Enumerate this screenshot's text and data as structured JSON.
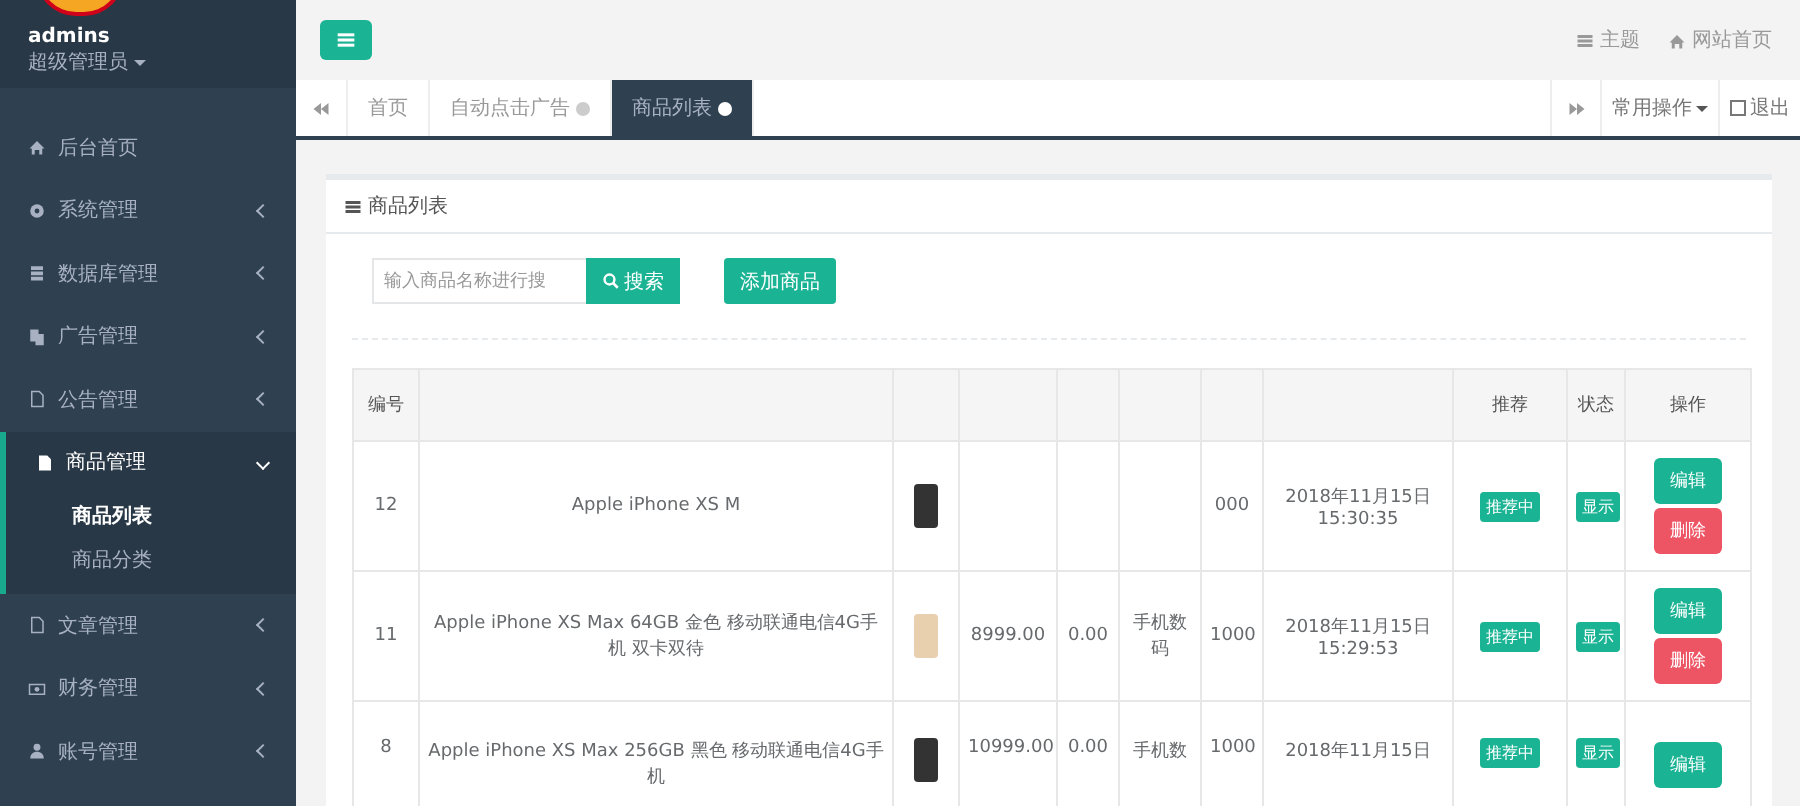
{
  "sidebar": {
    "user": {
      "name": "admins",
      "role": "超级管理员"
    },
    "items": [
      {
        "label": "后台首页",
        "has_children": false,
        "expanded": false
      },
      {
        "label": "系统管理",
        "has_children": true,
        "expanded": false
      },
      {
        "label": "数据库管理",
        "has_children": true,
        "expanded": false
      },
      {
        "label": "广告管理",
        "has_children": true,
        "expanded": false
      },
      {
        "label": "公告管理",
        "has_children": true,
        "expanded": false
      },
      {
        "label": "商品管理",
        "has_children": true,
        "expanded": true,
        "children": [
          {
            "label": "商品列表",
            "selected": true
          },
          {
            "label": "商品分类",
            "selected": false
          }
        ]
      },
      {
        "label": "文章管理",
        "has_children": true,
        "expanded": false
      },
      {
        "label": "财务管理",
        "has_children": true,
        "expanded": false
      },
      {
        "label": "账号管理",
        "has_children": true,
        "expanded": false
      }
    ]
  },
  "header": {
    "links": [
      {
        "label": "主题"
      },
      {
        "label": "网站首页"
      }
    ]
  },
  "tabs": [
    {
      "label": "首页",
      "closable": false,
      "selected": false
    },
    {
      "label": "自动点击广告",
      "closable": true,
      "selected": false
    },
    {
      "label": "商品列表",
      "closable": true,
      "selected": true
    }
  ],
  "tab_actions": [
    {
      "label": "常用操作",
      "kind": "dropdown"
    },
    {
      "label": "退出",
      "kind": "exit"
    }
  ],
  "panel": {
    "title": "商品列表",
    "search": {
      "placeholder": "输入商品名称进行搜"
    },
    "search_button": "搜索",
    "add_button": "添加商品"
  },
  "table": {
    "columns": [
      "编号",
      "推荐",
      "状态",
      "操作"
    ],
    "rows": [
      {
        "id": "12",
        "name": "Apple iPhone XS M",
        "stock": "000",
        "time": "2018年11月15日 15:30:35",
        "recommend": "推荐中",
        "status": "显示",
        "actions": [
          "编辑",
          "删除"
        ]
      },
      {
        "id": "11",
        "name": "Apple iPhone XS Max 64GB 金色 移动联通电信4G手机 双卡双待",
        "price": "8999.00",
        "column_5": "0.00",
        "category": "手机数码",
        "stock": "1000",
        "time": "2018年11月15日 15:29:53",
        "recommend": "推荐中",
        "status": "显示",
        "actions": [
          "编辑",
          "删除"
        ]
      },
      {
        "id": "8",
        "name": "Apple iPhone XS Max 256GB 黑色 移动联通电信4G手机",
        "price": "10999.00",
        "column_5": "0.00",
        "category": "手机数",
        "stock": "1000",
        "time": "2018年11月15日",
        "recommend": "推荐中",
        "status": "显示",
        "actions": [
          "编辑"
        ]
      }
    ]
  }
}
